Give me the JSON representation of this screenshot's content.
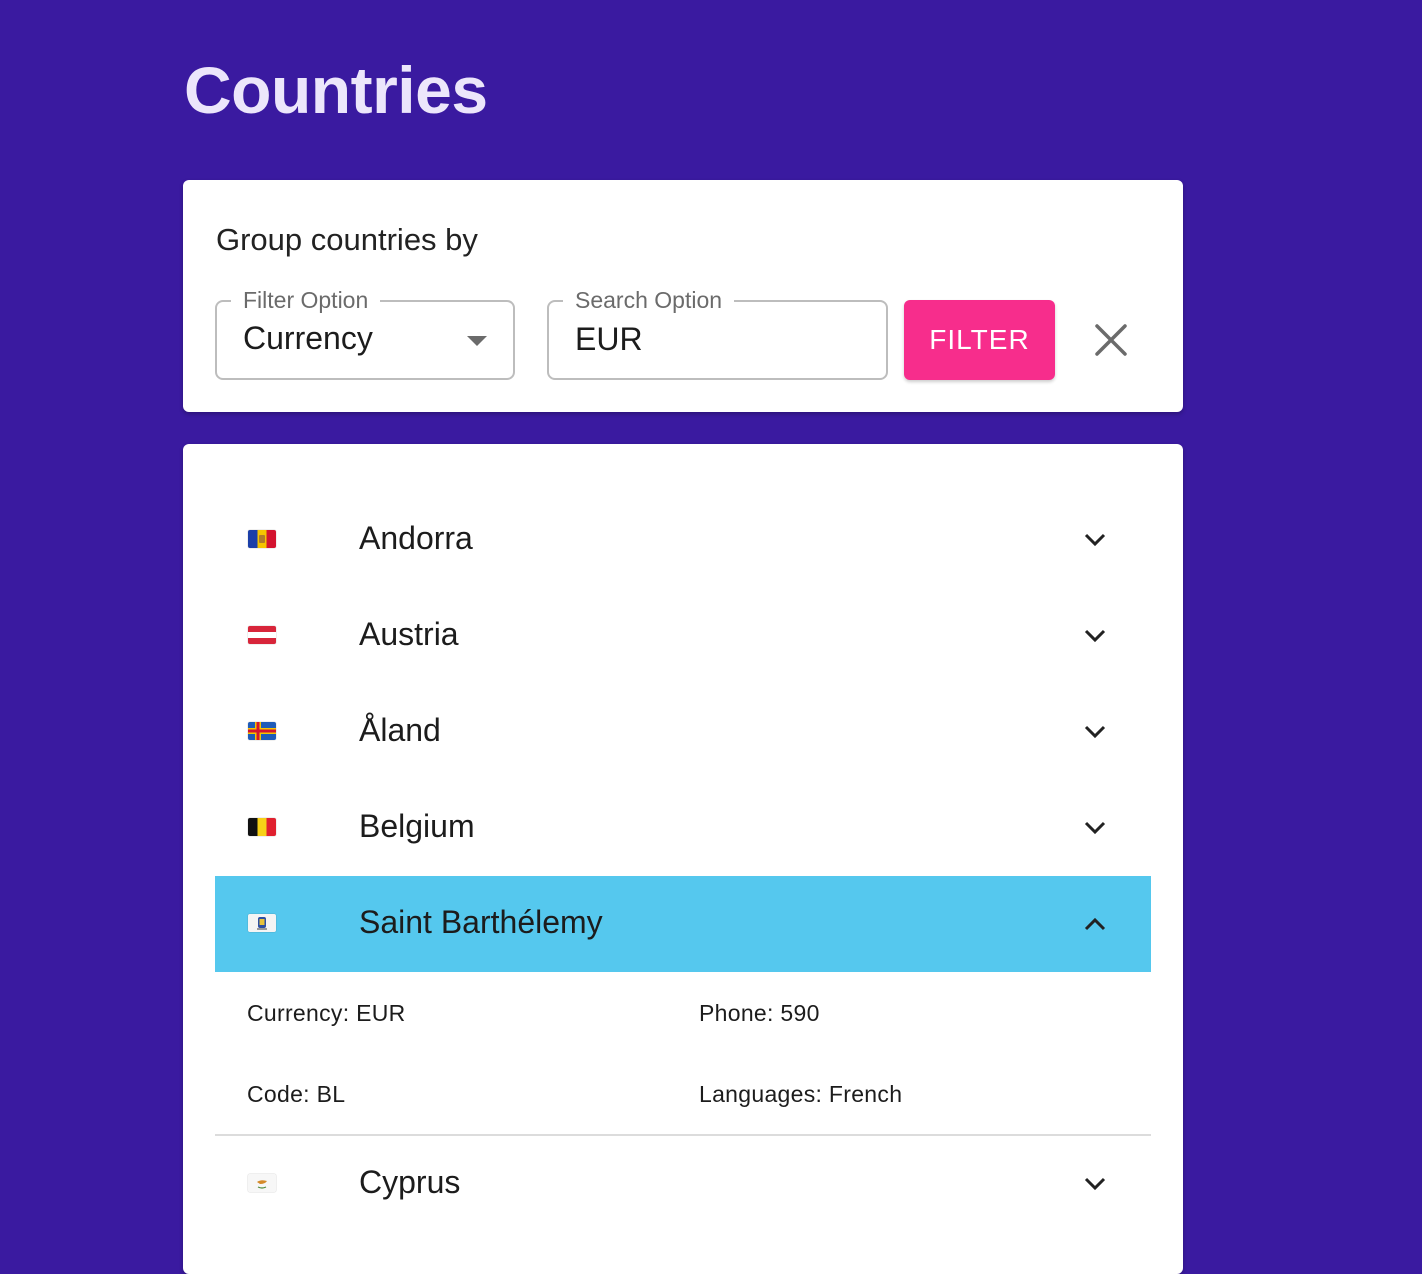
{
  "page": {
    "title": "Countries"
  },
  "filter": {
    "group_label": "Group countries by",
    "filter_option_label": "Filter Option",
    "filter_option_value": "Currency",
    "search_option_label": "Search Option",
    "search_option_value": "EUR",
    "filter_button_label": "FILTER"
  },
  "countries": [
    {
      "name": "Andorra",
      "flag": "andorra-flag-icon"
    },
    {
      "name": "Austria",
      "flag": "austria-flag-icon"
    },
    {
      "name": "Åland",
      "flag": "aland-flag-icon"
    },
    {
      "name": "Belgium",
      "flag": "belgium-flag-icon"
    },
    {
      "name": "Saint Barthélemy",
      "flag": "saint-barthelemy-flag-icon",
      "expanded": true
    },
    {
      "name": "Cyprus",
      "flag": "cyprus-flag-icon"
    }
  ],
  "expanded_details": {
    "currency": "Currency: EUR",
    "phone": "Phone: 590",
    "code": "Code: BL",
    "languages": "Languages: French"
  },
  "colors": {
    "background": "#3a1aa0",
    "accent": "#f72d8c",
    "expanded_row": "#55c8ee"
  }
}
